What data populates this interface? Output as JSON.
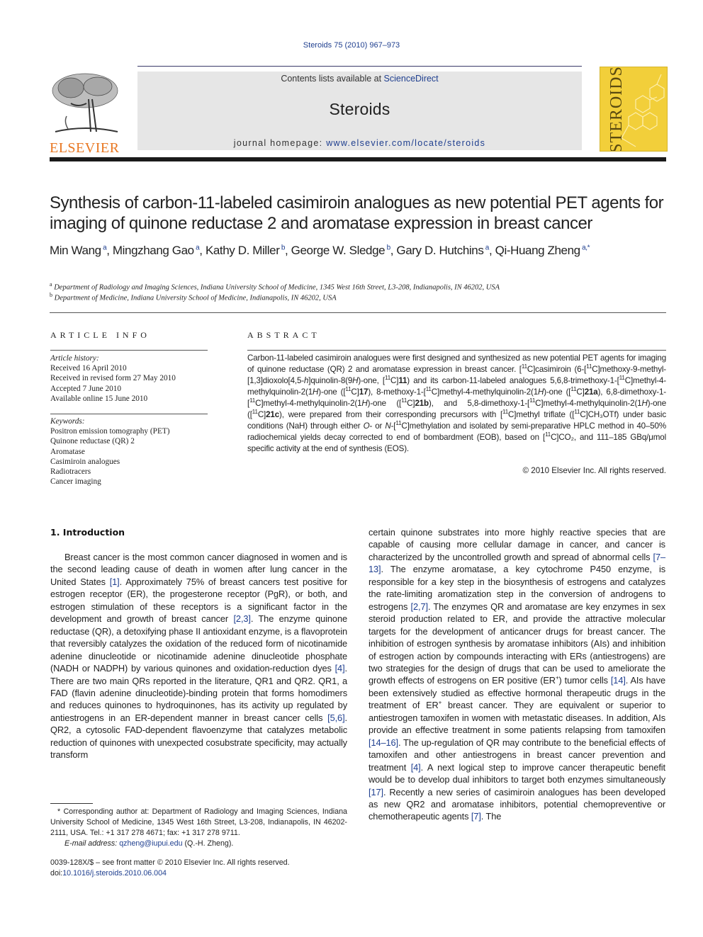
{
  "header": {
    "citation": "Steroids 75 (2010) 967–973",
    "contents_prefix": "Contents lists available at ",
    "contents_link": "ScienceDirect",
    "journal_title": "Steroids",
    "homepage_prefix": "journal homepage: ",
    "homepage_link": "www.elsevier.com/locate/steroids",
    "publisher_logo": "ELSEVIER",
    "cover_title": "STEROIDS",
    "colors": {
      "link": "#1f3f8f",
      "publisher_orange": "#e87722",
      "cover_yellow": "#f2cf3a",
      "header_band": "#e6e6e6"
    }
  },
  "article": {
    "title": "Synthesis of carbon-11-labeled casimiroin analogues as new potential PET agents for imaging of quinone reductase 2 and aromatase expression in breast cancer",
    "authors": [
      {
        "name": "Min Wang",
        "aff": "a"
      },
      {
        "name": "Mingzhang Gao",
        "aff": "a"
      },
      {
        "name": "Kathy D. Miller",
        "aff": "b"
      },
      {
        "name": "George W. Sledge",
        "aff": "b"
      },
      {
        "name": "Gary D. Hutchins",
        "aff": "a"
      },
      {
        "name": "Qi-Huang Zheng",
        "aff": "a,*"
      }
    ],
    "affiliations": [
      {
        "mark": "a",
        "text": "Department of Radiology and Imaging Sciences, Indiana University School of Medicine, 1345 West 16th Street, L3-208, Indianapolis, IN 46202, USA"
      },
      {
        "mark": "b",
        "text": "Department of Medicine, Indiana University School of Medicine, Indianapolis, IN 46202, USA"
      }
    ]
  },
  "article_info": {
    "heading": "ARTICLE INFO",
    "history_label": "Article history:",
    "history": [
      "Received 16 April 2010",
      "Received in revised form 27 May 2010",
      "Accepted 7 June 2010",
      "Available online 15 June 2010"
    ],
    "keywords_label": "Keywords:",
    "keywords": [
      "Positron emission tomography (PET)",
      "Quinone reductase (QR) 2",
      "Aromatase",
      "Casimiroin analogues",
      "Radiotracers",
      "Cancer imaging"
    ]
  },
  "abstract": {
    "heading": "ABSTRACT",
    "segments": [
      {
        "t": "Carbon-11-labeled casimiroin analogues were first designed and synthesized as new potential PET agents for imaging of quinone reductase (QR) 2 and aromatase expression in breast cancer. ["
      },
      {
        "sup": "11"
      },
      {
        "t": "C]casimiroin (6-["
      },
      {
        "sup": "11"
      },
      {
        "t": "C]methoxy-9-methyl-[1,3]dioxolo[4,5-"
      },
      {
        "i": "h"
      },
      {
        "t": "]quinolin-8(9"
      },
      {
        "i": "H"
      },
      {
        "t": ")-one, ["
      },
      {
        "sup": "11"
      },
      {
        "t": "C]"
      },
      {
        "b": "11"
      },
      {
        "t": ") and its carbon-11-labeled analogues 5,6,8-trimethoxy-1-["
      },
      {
        "sup": "11"
      },
      {
        "t": "C]methyl-4-methylquinolin-2(1"
      },
      {
        "i": "H"
      },
      {
        "t": ")-one (["
      },
      {
        "sup": "11"
      },
      {
        "t": "C]"
      },
      {
        "b": "17"
      },
      {
        "t": "), 8-methoxy-1-["
      },
      {
        "sup": "11"
      },
      {
        "t": "C]methyl-4-methylquinolin-2(1"
      },
      {
        "i": "H"
      },
      {
        "t": ")-one (["
      },
      {
        "sup": "11"
      },
      {
        "t": "C]"
      },
      {
        "b": "21a"
      },
      {
        "t": "), 6,8-dimethoxy-1-["
      },
      {
        "sup": "11"
      },
      {
        "t": "C]methyl-4-methylquinolin-2(1"
      },
      {
        "i": "H"
      },
      {
        "t": ")-one (["
      },
      {
        "sup": "11"
      },
      {
        "t": "C]"
      },
      {
        "b": "21b"
      },
      {
        "t": "), and 5,8-dimethoxy-1-["
      },
      {
        "sup": "11"
      },
      {
        "t": "C]methyl-4-methylquinolin-2(1"
      },
      {
        "i": "H"
      },
      {
        "t": ")-one (["
      },
      {
        "sup": "11"
      },
      {
        "t": "C]"
      },
      {
        "b": "21c"
      },
      {
        "t": "), were prepared from their corresponding precursors with ["
      },
      {
        "sup": "11"
      },
      {
        "t": "C]methyl triflate (["
      },
      {
        "sup": "11"
      },
      {
        "t": "C]CH₃OTf) under basic conditions (NaH) through either "
      },
      {
        "i": "O"
      },
      {
        "t": "- or "
      },
      {
        "i": "N"
      },
      {
        "t": "-["
      },
      {
        "sup": "11"
      },
      {
        "t": "C]methylation and isolated by semi-preparative HPLC method in 40–50% radiochemical yields decay corrected to end of bombardment (EOB), based on ["
      },
      {
        "sup": "11"
      },
      {
        "t": "C]CO₂, and 111–185 GBq/μmol specific activity at the end of synthesis (EOS)."
      }
    ],
    "copyright": "© 2010 Elsevier Inc. All rights reserved."
  },
  "introduction": {
    "heading": "1.  Introduction",
    "left_segments": [
      {
        "t": "Breast cancer is the most common cancer diagnosed in women and is the second leading cause of death in women after lung cancer in the United States "
      },
      {
        "ref": "[1]"
      },
      {
        "t": ". Approximately 75% of breast cancers test positive for estrogen receptor (ER), the progesterone receptor (PgR), or both, and estrogen stimulation of these receptors is a significant factor in the development and growth of breast cancer "
      },
      {
        "ref": "[2,3]"
      },
      {
        "t": ". The enzyme quinone reductase (QR), a detoxifying phase II antioxidant enzyme, is a flavoprotein that reversibly catalyzes the oxidation of the reduced form of nicotinamide adenine dinucleotide or nicotinamide adenine dinucleotide phosphate (NADH or NADPH) by various quinones and oxidation-reduction dyes "
      },
      {
        "ref": "[4]"
      },
      {
        "t": ". There are two main QRs reported in the literature, QR1 and QR2. QR1, a FAD (flavin adenine dinucleotide)-binding protein that forms homodimers and reduces quinones to hydroquinones, has its activity up regulated by antiestrogens in an ER-dependent manner in breast cancer cells "
      },
      {
        "ref": "[5,6]"
      },
      {
        "t": ". QR2, a cytosolic FAD-dependent flavoenzyme that catalyzes metabolic reduction of quinones with unexpected cosubstrate specificity, may actually transform"
      }
    ],
    "right_segments": [
      {
        "t": "certain quinone substrates into more highly reactive species that are capable of causing more cellular damage in cancer, and cancer is characterized by the uncontrolled growth and spread of abnormal cells "
      },
      {
        "ref": "[7–13]"
      },
      {
        "t": ". The enzyme aromatase, a key cytochrome P450 enzyme, is responsible for a key step in the biosynthesis of estrogens and catalyzes the rate-limiting aromatization step in the conversion of androgens to estrogens "
      },
      {
        "ref": "[2,7]"
      },
      {
        "t": ". The enzymes QR and aromatase are key enzymes in sex steroid production related to ER, and provide the attractive molecular targets for the development of anticancer drugs for breast cancer. The inhibition of estrogen synthesis by aromatase inhibitors (AIs) and inhibition of estrogen action by compounds interacting with ERs (antiestrogens) are two strategies for the design of drugs that can be used to ameliorate the growth effects of estrogens on ER positive (ER"
      },
      {
        "sup": "+"
      },
      {
        "t": ") tumor cells "
      },
      {
        "ref": "[14]"
      },
      {
        "t": ". AIs have been extensively studied as effective hormonal therapeutic drugs in the treatment of ER"
      },
      {
        "sup": "+"
      },
      {
        "t": " breast cancer. They are equivalent or superior to antiestrogen tamoxifen in women with metastatic diseases. In addition, AIs provide an effective treatment in some patients relapsing from tamoxifen "
      },
      {
        "ref": "[14–16]"
      },
      {
        "t": ". The up-regulation of QR may contribute to the beneficial effects of tamoxifen and other antiestrogens in breast cancer prevention and treatment "
      },
      {
        "ref": "[4]"
      },
      {
        "t": ". A next logical step to improve cancer therapeutic benefit would be to develop dual inhibitors to target both enzymes simultaneously "
      },
      {
        "ref": "[17]"
      },
      {
        "t": ". Recently a new series of casimiroin analogues has been developed as new QR2 and aromatase inhibitors, potential chemopreventive or chemotherapeutic agents "
      },
      {
        "ref": "[7]"
      },
      {
        "t": ". The"
      }
    ]
  },
  "footnote": {
    "corresponding": "* Corresponding author at: Department of Radiology and Imaging Sciences, Indiana University School of Medicine, 1345 West 16th Street, L3-208, Indianapolis, IN 46202-2111, USA. Tel.: +1 317 278 4671; fax: +1 317 278 9711.",
    "email_label": "E-mail address: ",
    "email": "qzheng@iupui.edu",
    "email_suffix": " (Q.-H. Zheng)."
  },
  "front_matter": {
    "issn_line": "0039-128X/$ – see front matter © 2010 Elsevier Inc. All rights reserved.",
    "doi_prefix": "doi:",
    "doi": "10.1016/j.steroids.2010.06.004"
  }
}
